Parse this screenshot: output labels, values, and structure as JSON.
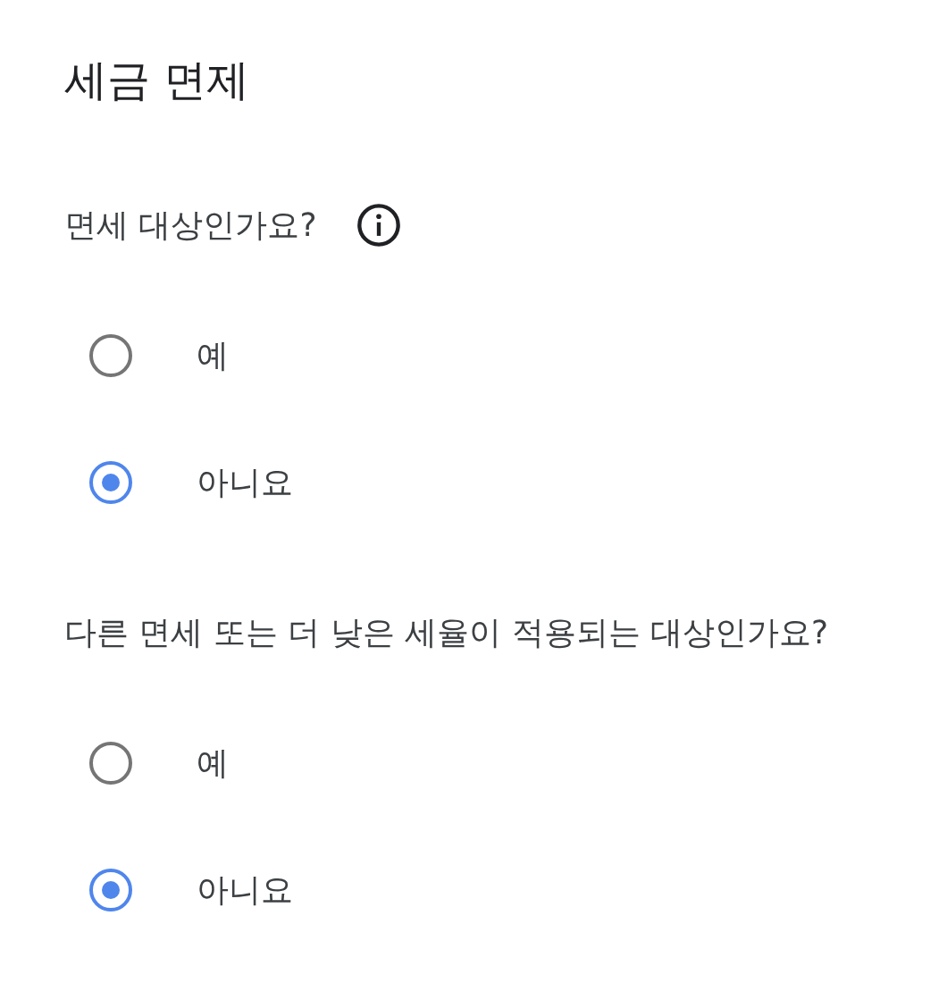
{
  "title": "세금 면제",
  "questions": [
    {
      "label": "면세 대상인가요?",
      "info": true,
      "options": [
        {
          "label": "예",
          "selected": false
        },
        {
          "label": "아니요",
          "selected": true
        }
      ]
    },
    {
      "label": "다른 면세 또는 더 낮은 세율이 적용되는 대상인가요?",
      "info": false,
      "options": [
        {
          "label": "예",
          "selected": false
        },
        {
          "label": "아니요",
          "selected": true
        }
      ]
    }
  ]
}
